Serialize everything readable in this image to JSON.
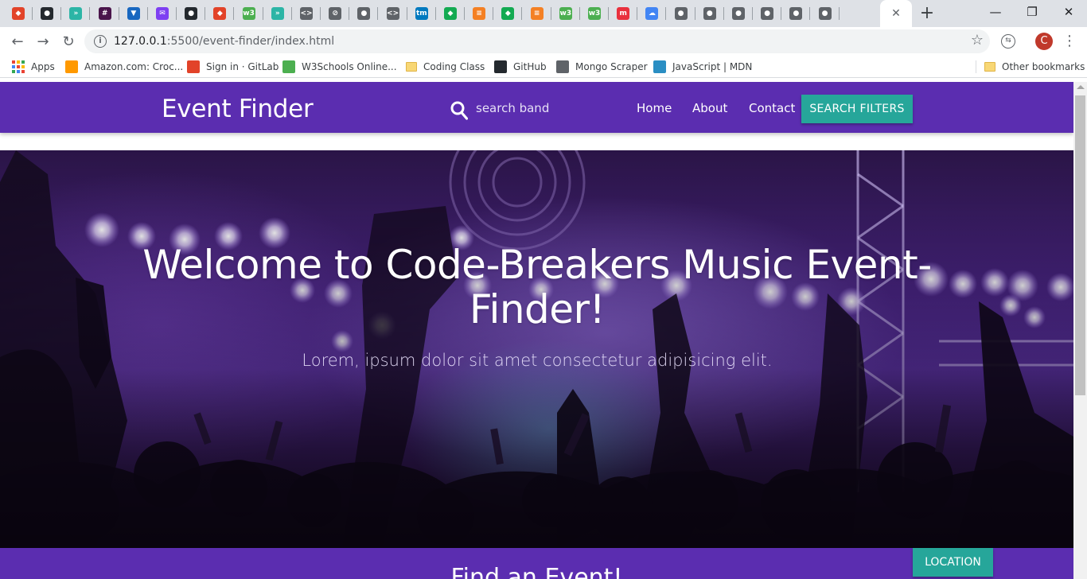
{
  "browser": {
    "tabs": [
      {
        "icon": "gitlab-icon",
        "color": "#e24329",
        "glyph": "◆"
      },
      {
        "icon": "github-icon",
        "color": "#24292e",
        "glyph": "●"
      },
      {
        "icon": "codewars-icon",
        "color": "#2cb5a6",
        "glyph": "»"
      },
      {
        "icon": "slack-icon",
        "color": "#4a154b",
        "glyph": "#"
      },
      {
        "icon": "vuetify-icon",
        "color": "#1867c0",
        "glyph": "▼"
      },
      {
        "icon": "mail-icon",
        "color": "#7e3ff2",
        "glyph": "✉"
      },
      {
        "icon": "github-icon",
        "color": "#24292e",
        "glyph": "●"
      },
      {
        "icon": "gitlab-icon",
        "color": "#e24329",
        "glyph": "◆"
      },
      {
        "icon": "w3schools-icon",
        "color": "#4caf50",
        "glyph": "w3"
      },
      {
        "icon": "codewars-icon",
        "color": "#2cb5a6",
        "glyph": "»"
      },
      {
        "icon": "code-icon",
        "color": "#5f6368",
        "glyph": "<>"
      },
      {
        "icon": "compass-icon",
        "color": "#5f6368",
        "glyph": "⊘"
      },
      {
        "icon": "globe-icon",
        "color": "#5f6368",
        "glyph": "●"
      },
      {
        "icon": "code-icon",
        "color": "#5f6368",
        "glyph": "<>"
      },
      {
        "icon": "trello-icon",
        "color": "#0079bf",
        "glyph": "tm"
      },
      {
        "icon": "mongo-icon",
        "color": "#13aa52",
        "glyph": "◆"
      },
      {
        "icon": "stackoverflow-icon",
        "color": "#f48024",
        "glyph": "≡"
      },
      {
        "icon": "mongo-icon",
        "color": "#13aa52",
        "glyph": "◆"
      },
      {
        "icon": "stackoverflow-icon",
        "color": "#f48024",
        "glyph": "≡"
      },
      {
        "icon": "w3schools-icon",
        "color": "#4caf50",
        "glyph": "w3"
      },
      {
        "icon": "w3schools-icon",
        "color": "#4caf50",
        "glyph": "w3"
      },
      {
        "icon": "mdn-icon",
        "color": "#e9303d",
        "glyph": "m"
      },
      {
        "icon": "google-cloud-icon",
        "color": "#4285f4",
        "glyph": "☁"
      },
      {
        "icon": "globe-icon",
        "color": "#5f6368",
        "glyph": "●"
      },
      {
        "icon": "globe-icon",
        "color": "#5f6368",
        "glyph": "●"
      },
      {
        "icon": "globe-icon",
        "color": "#5f6368",
        "glyph": "●"
      },
      {
        "icon": "globe-icon",
        "color": "#5f6368",
        "glyph": "●"
      },
      {
        "icon": "globe-icon",
        "color": "#5f6368",
        "glyph": "●"
      },
      {
        "icon": "globe-icon",
        "color": "#5f6368",
        "glyph": "●"
      }
    ],
    "active_tab_close": "✕",
    "new_tab": "+",
    "window_controls": {
      "minimize": "—",
      "maximize": "❐",
      "close": "✕"
    },
    "nav": {
      "back": "←",
      "forward": "→",
      "reload": "↻"
    },
    "url_host": "127.0.0.1",
    "url_rest": ":5500/event-finder/index.html",
    "star": "☆",
    "profile_initial": "C",
    "menu": "⋮",
    "bookmarks": [
      {
        "label": "Apps",
        "icon": "apps-grid-icon",
        "color": ""
      },
      {
        "label": "Amazon.com: Croc...",
        "icon": "amazon-icon",
        "color": "#ff9900"
      },
      {
        "label": "Sign in · GitLab",
        "icon": "gitlab-icon",
        "color": "#e24329"
      },
      {
        "label": "W3Schools Online...",
        "icon": "w3schools-icon",
        "color": "#4caf50"
      },
      {
        "label": "Coding Class",
        "icon": "folder-icon",
        "color": "#f8d775"
      },
      {
        "label": "GitHub",
        "icon": "github-icon",
        "color": "#24292e"
      },
      {
        "label": "Mongo Scraper",
        "icon": "globe-icon",
        "color": "#5f6368"
      },
      {
        "label": "JavaScript | MDN",
        "icon": "mdn-icon",
        "color": "#2a8ec3"
      }
    ],
    "other_bookmarks": "Other bookmarks"
  },
  "site": {
    "brand": "Event Finder",
    "search_placeholder": "search band",
    "nav_links": [
      "Home",
      "About",
      "Contact"
    ],
    "filters_button": "SEARCH FILTERS",
    "hero_title": "Welcome to Code-Breakers Music Event-Finder!",
    "hero_subtitle": "Lorem, ipsum dolor sit amet consectetur adipisicing elit.",
    "find_title": "Find an Event!",
    "location_button": "LOCATION"
  },
  "colors": {
    "nav_purple": "#5b2db0",
    "teal_button": "#26a69a",
    "chrome_tabstrip": "#dee1e6"
  }
}
